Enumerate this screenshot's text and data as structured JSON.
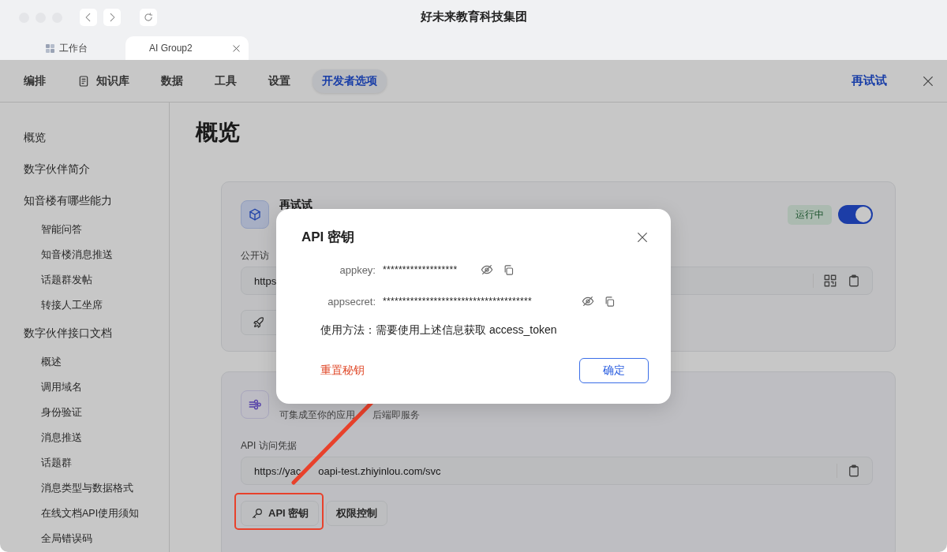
{
  "window": {
    "title": "好未来教育科技集团"
  },
  "browser_tabs": [
    {
      "label": "工作台",
      "selected": false
    },
    {
      "label": "AI Group2",
      "selected": true
    }
  ],
  "nav": {
    "items": [
      {
        "label": "编排",
        "kind": "plain",
        "selected": false
      },
      {
        "label": "知识库",
        "kind": "icon",
        "selected": false
      },
      {
        "label": "数据",
        "kind": "plain",
        "selected": false
      },
      {
        "label": "工具",
        "kind": "plain",
        "selected": false
      },
      {
        "label": "设置",
        "kind": "plain",
        "selected": false
      },
      {
        "label": "开发者选项",
        "kind": "plain",
        "selected": true
      }
    ],
    "retry_link": "再试试"
  },
  "sidebar": {
    "items": [
      {
        "label": "概览"
      },
      {
        "label": "数字伙伴简介"
      },
      {
        "label": "知音楼有哪些能力",
        "children": [
          {
            "label": "智能问答"
          },
          {
            "label": "知音楼消息推送"
          },
          {
            "label": "话题群发帖"
          },
          {
            "label": "转接人工坐席"
          }
        ]
      },
      {
        "label": "数字伙伴接口文档",
        "children": [
          {
            "label": "概述"
          },
          {
            "label": "调用域名"
          },
          {
            "label": "身份验证"
          },
          {
            "label": "消息推送"
          },
          {
            "label": "话题群"
          },
          {
            "label": "消息类型与数据格式"
          },
          {
            "label": "在线文档API使用须知"
          },
          {
            "label": "全局错误码"
          }
        ]
      }
    ]
  },
  "page_title": "概览",
  "cards": [
    {
      "kind": "web",
      "title": "再试试",
      "status": "运行中",
      "on": true,
      "field_label": "公开访",
      "field_value_parts": [
        "https"
      ],
      "buttons": [
        {
          "kind": "icon_only"
        }
      ]
    },
    {
      "kind": "api",
      "description_parts": [
        "可集成至你的应用",
        "后端即服务"
      ],
      "field_label": "API 访问凭据",
      "field_value_parts": [
        "https://yac",
        "oapi-test.zhiyinlou.com/svc"
      ],
      "buttons": [
        {
          "kind": "icon",
          "label": "API 密钥"
        },
        {
          "kind": "plain",
          "label": "权限控制"
        }
      ]
    }
  ],
  "dialog": {
    "title": "API 密钥",
    "fields": [
      {
        "label": "appkey:",
        "value": "*******************"
      },
      {
        "label": "appsecret:",
        "value": "**************************************"
      }
    ],
    "usage": "使用方法：需要使用上述信息获取 access_token",
    "reset_link": "重置秘钥",
    "confirm": "确定"
  }
}
